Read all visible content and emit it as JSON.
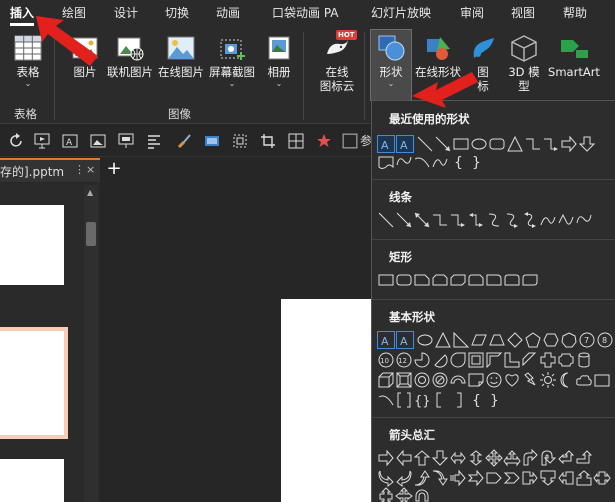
{
  "ribbon_tabs": [
    {
      "label": "插入",
      "active": true
    },
    {
      "label": "绘图"
    },
    {
      "label": "设计"
    },
    {
      "label": "切换"
    },
    {
      "label": "动画"
    },
    {
      "label": "口袋动画 PA"
    },
    {
      "label": "幻灯片放映"
    },
    {
      "label": "审阅"
    },
    {
      "label": "视图"
    },
    {
      "label": "帮助"
    }
  ],
  "ribbon": {
    "table": {
      "label": "表格",
      "group": "表格"
    },
    "picture": {
      "label": "图片"
    },
    "online_picture": {
      "label": "联机图片"
    },
    "online_image": {
      "label": "在线图片"
    },
    "screenshot": {
      "label": "屏幕截图"
    },
    "album": {
      "label": "相册"
    },
    "image_group": "图像",
    "online_icon_lib": {
      "line1": "在线",
      "line2": "图标云",
      "badge": "HOT"
    },
    "shapes": {
      "label": "形状"
    },
    "online_shapes": {
      "label": "在线形状"
    },
    "icons": {
      "line1": "图",
      "line2": "标"
    },
    "model3d": {
      "line1": "3D 模",
      "line2": "型"
    },
    "smartart": {
      "label": "SmartArt"
    }
  },
  "quickbar": {
    "partial_label": "参"
  },
  "document": {
    "tab_label": "存的].pptm",
    "dots": "⋮",
    "close": "×",
    "new_tab": "+"
  },
  "shapes_panel": {
    "sections": [
      {
        "title": "最近使用的形状"
      },
      {
        "title": "线条"
      },
      {
        "title": "矩形"
      },
      {
        "title": "基本形状"
      },
      {
        "title": "箭头总汇"
      }
    ]
  },
  "colors": {
    "accent_red": "#e3211c",
    "selection_blue": "#3a8ee6",
    "ribbon_bg": "#2b2b2b",
    "panel_bg": "#2d2d2d"
  }
}
